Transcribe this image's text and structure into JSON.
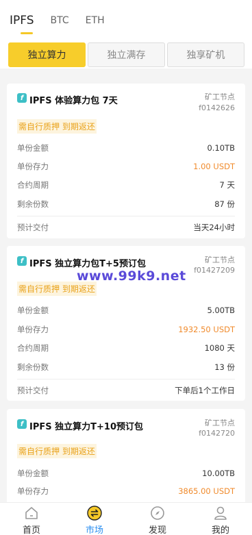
{
  "coin_tabs": [
    "IPFS",
    "BTC",
    "ETH"
  ],
  "segments": [
    "独立算力",
    "独立满存",
    "独享矿机"
  ],
  "cards": [
    {
      "title": "IPFS 体验算力包 7天",
      "node_label": "矿工节点",
      "node_id": "f0142626",
      "tag": "需自行质押 到期返还",
      "rows": [
        {
          "k": "单份金额",
          "v": "0.10TB"
        },
        {
          "k": "单份存力",
          "v": "1.00 USDT"
        },
        {
          "k": "合约周期",
          "v": "7 天"
        },
        {
          "k": "剩余份数",
          "v": "87 份"
        }
      ],
      "delivery_label": "预计交付",
      "delivery_value": "当天24小时"
    },
    {
      "title": "IPFS 独立算力包T+5预订包",
      "node_label": "矿工节点",
      "node_id": "f01427209",
      "tag": "需自行质押 到期返还",
      "rows": [
        {
          "k": "单份金额",
          "v": "5.00TB"
        },
        {
          "k": "单份存力",
          "v": "1932.50 USDT"
        },
        {
          "k": "合约周期",
          "v": "1080 天"
        },
        {
          "k": "剩余份数",
          "v": "13 份"
        }
      ],
      "delivery_label": "预计交付",
      "delivery_value": "下单后1个工作日"
    },
    {
      "title": "IPFS 独立算力T+10预订包",
      "node_label": "矿工节点",
      "node_id": "f0142720",
      "tag": "需自行质押 到期返还",
      "rows": [
        {
          "k": "单份金额",
          "v": "10.00TB"
        },
        {
          "k": "单份存力",
          "v": "3865.00 USDT"
        }
      ]
    }
  ],
  "watermark": "www.99k9.net",
  "nav": [
    "首页",
    "市场",
    "发现",
    "我的"
  ],
  "colors": {
    "accent": "#f7cd2b",
    "price": "#f08a2b",
    "nav_active": "#2c8ff0",
    "tag": "#e9a21a"
  }
}
